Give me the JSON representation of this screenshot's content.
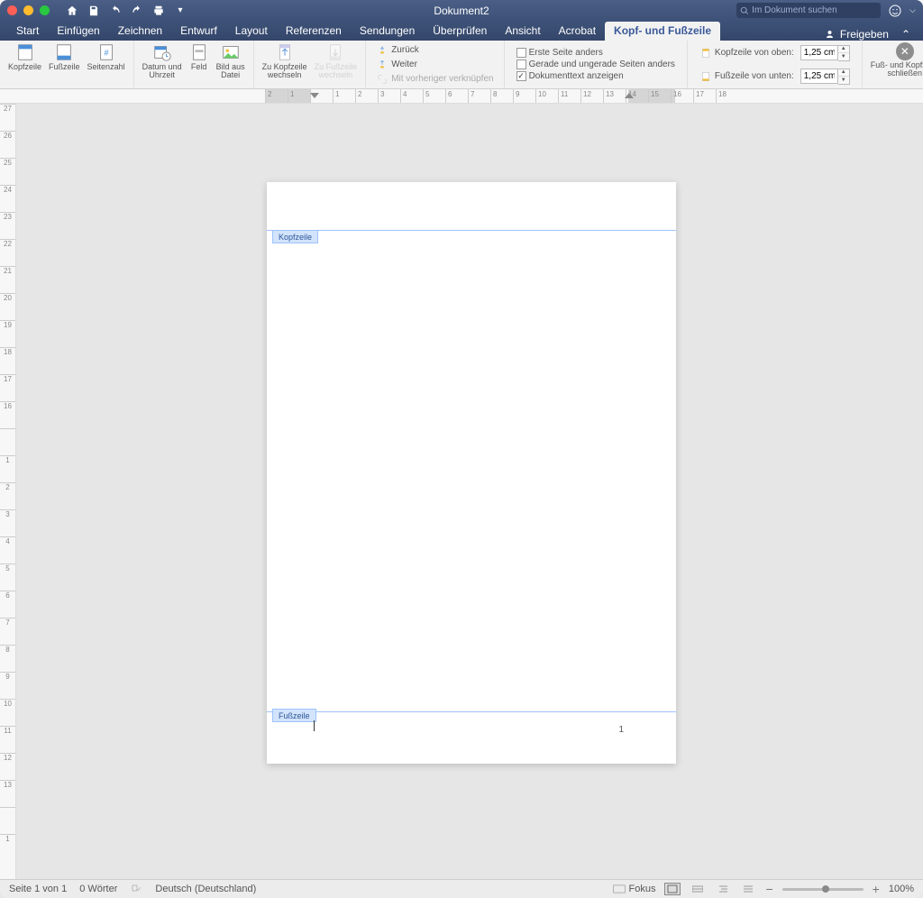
{
  "titlebar": {
    "document_title": "Dokument2",
    "search_placeholder": "Im Dokument suchen"
  },
  "tabs": {
    "items": [
      "Start",
      "Einfügen",
      "Zeichnen",
      "Entwurf",
      "Layout",
      "Referenzen",
      "Sendungen",
      "Überprüfen",
      "Ansicht",
      "Acrobat",
      "Kopf- und Fußzeile"
    ],
    "active_index": 10,
    "share_label": "Freigeben"
  },
  "ribbon": {
    "header_btn": "Kopfzeile",
    "footer_btn": "Fußzeile",
    "pagenum_btn": "Seitenzahl",
    "datetime_btn": "Datum und\nUhrzeit",
    "field_btn": "Feld",
    "picture_btn": "Bild aus\nDatei",
    "goto_header": "Zu Kopfzeile\nwechseln",
    "goto_footer": "Zu Fußzeile\nwechseln",
    "back": "Zurück",
    "next": "Weiter",
    "link_prev": "Mit vorheriger verknüpfen",
    "first_diff": "Erste Seite anders",
    "odd_even": "Gerade und ungerade Seiten anders",
    "show_body": "Dokumenttext anzeigen",
    "header_top_label": "Kopfzeile von oben:",
    "footer_bot_label": "Fußzeile von unten:",
    "header_top_value": "1,25 cm",
    "footer_bot_value": "1,25 cm",
    "close_label": "Fuß- und Kopfzeile\nschließen"
  },
  "document": {
    "header_tag": "Kopfzeile",
    "footer_tag": "Fußzeile",
    "footer_page_number": "1"
  },
  "ruler": {
    "hticks": [
      "2",
      "1",
      "",
      "1",
      "2",
      "3",
      "4",
      "5",
      "6",
      "7",
      "8",
      "9",
      "10",
      "11",
      "12",
      "13",
      "14",
      "15",
      "16",
      "17",
      "18"
    ]
  },
  "vruler_ticks": [
    "27",
    "26",
    "25",
    "24",
    "23",
    "22",
    "21",
    "20",
    "19",
    "18",
    "17",
    "16",
    "",
    "1",
    "2",
    "3",
    "4",
    "5",
    "6",
    "7",
    "8",
    "9",
    "10",
    "11",
    "12",
    "13",
    "",
    "1"
  ],
  "statusbar": {
    "page": "Seite 1 von 1",
    "words": "0 Wörter",
    "lang": "Deutsch (Deutschland)",
    "focus": "Fokus",
    "zoom": "100%"
  }
}
